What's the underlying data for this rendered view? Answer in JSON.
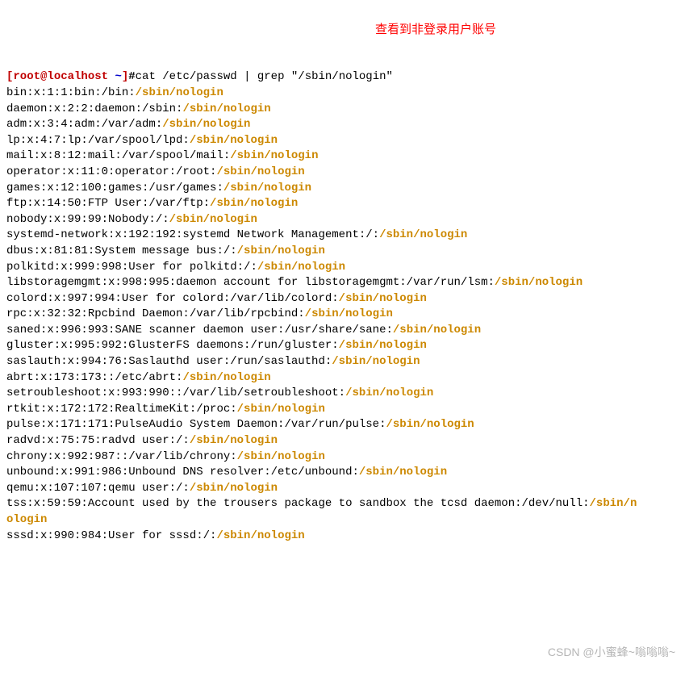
{
  "prompt": {
    "open": "[",
    "userhost": "root@localhost",
    "space": " ",
    "tilde": "~",
    "close": "]",
    "hash": "#",
    "command": "cat /etc/passwd | grep \"/sbin/nologin\""
  },
  "annotation": "查看到非登录用户账号",
  "watermark": "CSDN @小蜜蜂~嗡嗡嗡~",
  "hl": "/sbin/nologin",
  "lines": [
    "bin:x:1:1:bin:/bin:",
    "daemon:x:2:2:daemon:/sbin:",
    "adm:x:3:4:adm:/var/adm:",
    "lp:x:4:7:lp:/var/spool/lpd:",
    "mail:x:8:12:mail:/var/spool/mail:",
    "operator:x:11:0:operator:/root:",
    "games:x:12:100:games:/usr/games:",
    "ftp:x:14:50:FTP User:/var/ftp:",
    "nobody:x:99:99:Nobody:/:",
    "systemd-network:x:192:192:systemd Network Management:/:",
    "dbus:x:81:81:System message bus:/:",
    "polkitd:x:999:998:User for polkitd:/:",
    "libstoragemgmt:x:998:995:daemon account for libstoragemgmt:/var/run/lsm:",
    "colord:x:997:994:User for colord:/var/lib/colord:",
    "rpc:x:32:32:Rpcbind Daemon:/var/lib/rpcbind:",
    "saned:x:996:993:SANE scanner daemon user:/usr/share/sane:",
    "gluster:x:995:992:GlusterFS daemons:/run/gluster:",
    "saslauth:x:994:76:Saslauthd user:/run/saslauthd:",
    "abrt:x:173:173::/etc/abrt:",
    "setroubleshoot:x:993:990::/var/lib/setroubleshoot:",
    "rtkit:x:172:172:RealtimeKit:/proc:",
    "pulse:x:171:171:PulseAudio System Daemon:/var/run/pulse:",
    "radvd:x:75:75:radvd user:/:",
    "chrony:x:992:987::/var/lib/chrony:",
    "unbound:x:991:986:Unbound DNS resolver:/etc/unbound:",
    "qemu:x:107:107:qemu user:/:"
  ],
  "wrapline": {
    "part1": "tss:x:59:59:Account used by the trousers package to sandbox the tcsd daemon:/dev/null:",
    "wrap1": "/sbin/n",
    "wrap2": "ologin"
  },
  "lastline": "sssd:x:990:984:User for sssd:/:"
}
